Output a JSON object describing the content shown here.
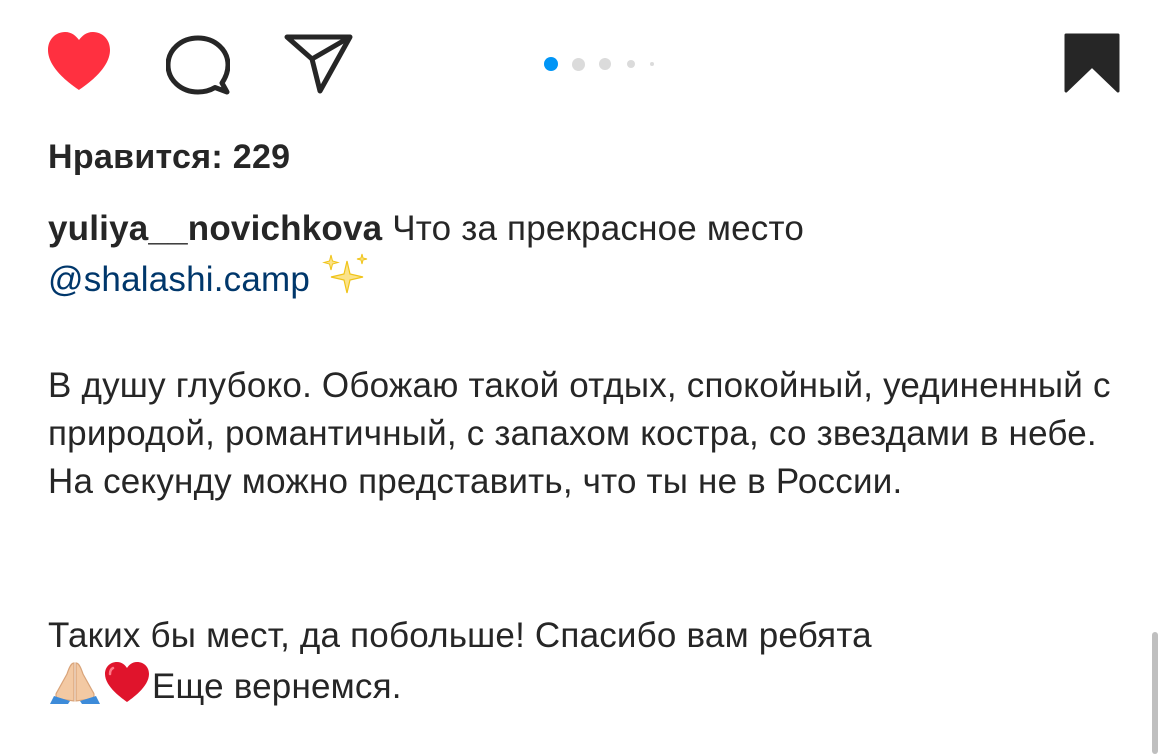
{
  "post": {
    "likes_text": "Нравится: 229",
    "caption": {
      "username": "yuliya__novichkova",
      "text": " Что за прекрасное место",
      "mention": "@shalashi.camp"
    },
    "paragraph1": "В душу глубоко. Обожаю такой отдых, спокойный, уединенный с природой, романтичный, с запахом костра, со звездами в небе. На секунду можно представить, что ты не в России.",
    "paragraph2_text1": "Таких бы мест, да побольше!  Спасибо вам ребята ",
    "paragraph2_text2": "Еще вернемся."
  },
  "carousel": {
    "total": 5,
    "active_index": 0,
    "active_color": "#0095f6",
    "inactive_color": "#dbdbdb"
  },
  "icons": {
    "like": "heart-filled-icon",
    "comment": "comment-bubble-icon",
    "share": "paper-plane-icon",
    "save": "bookmark-filled-icon",
    "sparkles": "sparkles-emoji",
    "pray": "folded-hands-emoji",
    "heart": "red-heart-emoji"
  },
  "colors": {
    "like": "#ff3040",
    "text": "#262626",
    "mention": "#00376b"
  }
}
